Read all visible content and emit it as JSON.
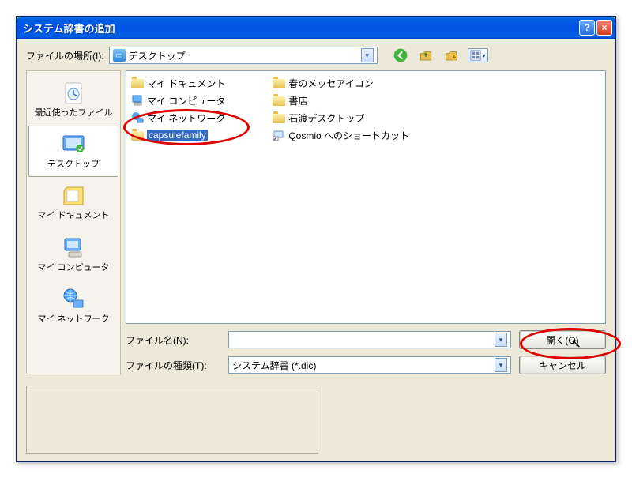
{
  "title": "システム辞書の追加",
  "lookin_label": "ファイルの場所(I):",
  "lookin_value": "デスクトップ",
  "places": {
    "recent": "最近使ったファイル",
    "desktop": "デスクトップ",
    "mydocs": "マイ ドキュメント",
    "mycomp": "マイ コンピュータ",
    "mynet": "マイ ネットワーク"
  },
  "files_col1": [
    {
      "icon": "folder",
      "label": "マイ ドキュメント"
    },
    {
      "icon": "mycomp",
      "label": "マイ コンピュータ"
    },
    {
      "icon": "mynet",
      "label": "マイ ネットワーク"
    },
    {
      "icon": "folder",
      "label": "capsulefamily",
      "selected": true
    }
  ],
  "files_col2": [
    {
      "icon": "folder",
      "label": "春のメッセアイコン"
    },
    {
      "icon": "folder",
      "label": "書店"
    },
    {
      "icon": "folder",
      "label": "石渡デスクトップ"
    },
    {
      "icon": "shortcut",
      "label": "Qosmio へのショートカット"
    }
  ],
  "filename_label": "ファイル名(N):",
  "filename_value": "",
  "filetype_label": "ファイルの種類(T):",
  "filetype_value": "システム辞書 (*.dic)",
  "open_button": "開く(O)",
  "cancel_button": "キャンセル"
}
